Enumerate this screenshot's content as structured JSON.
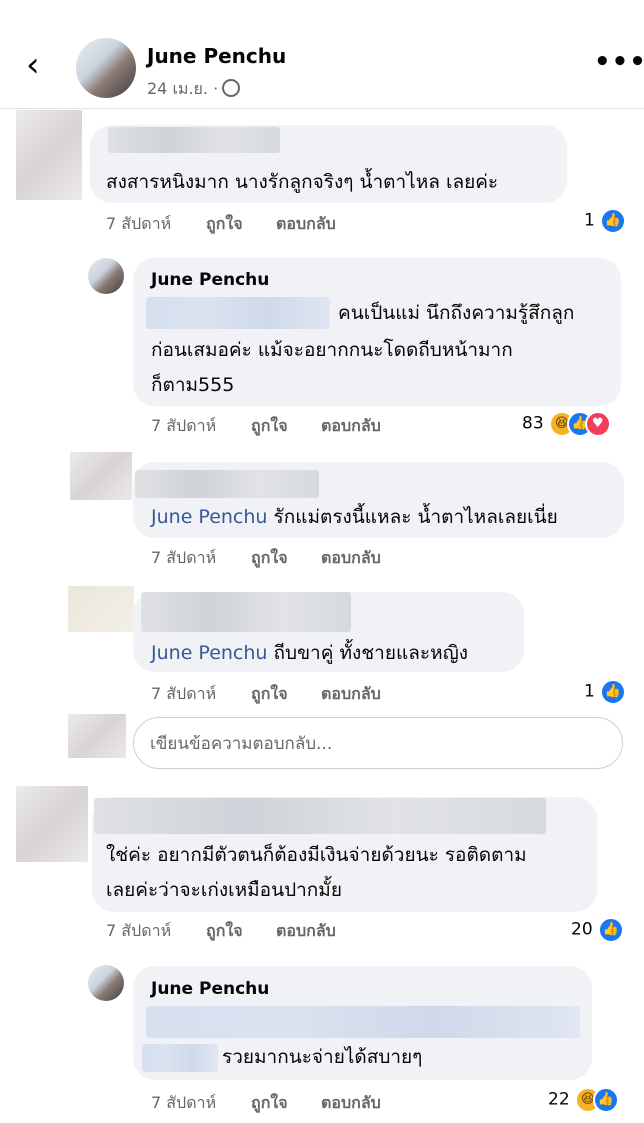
{
  "header": {
    "back_icon": "chevron-left-icon",
    "name": "June Penchu",
    "date": "24 เม.ย. ·",
    "privacy_icon": "globe-icon",
    "more_icon": "more-horizontal-icon"
  },
  "actions": {
    "like": "ถูกใจ",
    "reply": "ตอบกลับ"
  },
  "comments": [
    {
      "time": "7 สัปดาห์",
      "text": "สงสารหนิงมาก นางรักลูกจริงๆ น้ำตาไหล เลยค่ะ",
      "reaction_count": "1"
    },
    {
      "author": "June Penchu",
      "time": "7 สัปดาห์",
      "line1": "คนเป็นแม่ นึกถึงความรู้สึกลูก",
      "line2": "ก่อนเสมอค่ะ แม้จะอยากกนะโดดถีบหน้ามาก",
      "line3": "ก็ตาม555",
      "reaction_count": "83"
    },
    {
      "mention": "June Penchu",
      "time": "7 สัปดาห์",
      "text": " รักแม่ตรงนี้แหละ น้ำตาไหลเลยเนี่ย"
    },
    {
      "mention": "June Penchu",
      "time": "7 สัปดาห์",
      "text": " ถีบขาคู่ ทั้งชายและหญิง",
      "reaction_count": "1"
    },
    {
      "time": "7 สัปดาห์",
      "line1": "ใช่ค่ะ อยากมีตัวตนก็ต้องมีเงินจ่ายด้วยนะ รอติดตาม",
      "line2": "เลยค่ะว่าจะเก่งเหมือนปากมั้ย",
      "reaction_count": "20"
    },
    {
      "author": "June Penchu",
      "time": "7 สัปดาห์",
      "text": "รวยมากนะจ่ายได้สบายๆ",
      "reaction_count": "22"
    }
  ],
  "reply_input": {
    "placeholder": "เขียนข้อความตอบกลับ..."
  }
}
